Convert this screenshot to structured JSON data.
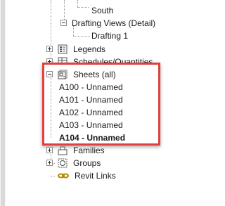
{
  "tree": {
    "south_label": "South",
    "drafting_views_label": "Drafting Views (Detail)",
    "drafting_1_label": "Drafting 1",
    "legends_label": "Legends",
    "schedules_label": "Schedules/Quantities",
    "sheets_label": "Sheets (all)",
    "sheets": [
      "A100 - Unnamed",
      "A101 - Unnamed",
      "A102 - Unnamed",
      "A103 - Unnamed",
      "A104 - Unnamed"
    ],
    "families_label": "Families",
    "groups_label": "Groups",
    "revit_links_label": "Revit Links"
  },
  "highlight_color": "#e0413f"
}
